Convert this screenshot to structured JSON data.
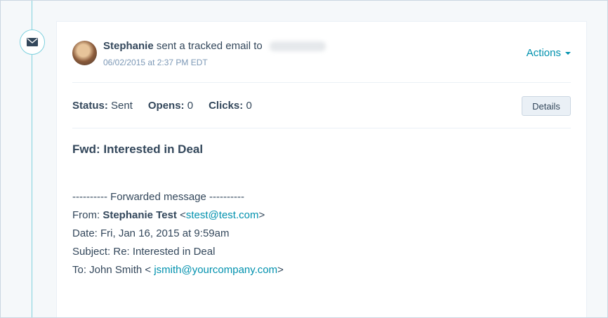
{
  "header": {
    "sender": "Stephanie",
    "action_text": "sent a tracked email to",
    "timestamp": "06/02/2015 at 2:37 PM EDT",
    "actions_label": "Actions"
  },
  "stats": {
    "status_label": "Status:",
    "status_value": "Sent",
    "opens_label": "Opens:",
    "opens_value": "0",
    "clicks_label": "Clicks:",
    "clicks_value": "0",
    "details_label": "Details"
  },
  "email": {
    "subject": "Fwd: Interested in Deal",
    "forward_line": "---------- Forwarded message ----------",
    "from_label": "From: ",
    "from_name": "Stephanie Test",
    "from_open": " <",
    "from_email": "stest@test.com",
    "from_close": ">",
    "date_line": "Date: Fri, Jan 16, 2015 at 9:59am",
    "subject_line": "Subject: Re: Interested in Deal",
    "to_label": "To: John Smith < ",
    "to_email": "jsmith@yourcompany.com",
    "to_close": ">"
  },
  "icons": {
    "timeline": "envelope-icon",
    "actions": "caret-down-icon"
  },
  "colors": {
    "accent": "#0091ae",
    "timeline": "#7fd1de",
    "text": "#33475b",
    "muted": "#7c98b6"
  }
}
